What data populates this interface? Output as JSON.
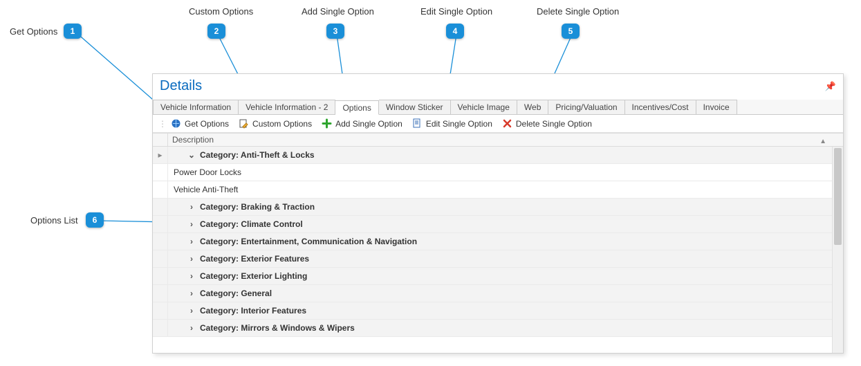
{
  "callouts": {
    "c1": {
      "num": "1",
      "label": "Get Options"
    },
    "c2": {
      "num": "2",
      "label": "Custom Options"
    },
    "c3": {
      "num": "3",
      "label": "Add Single Option"
    },
    "c4": {
      "num": "4",
      "label": "Edit Single Option"
    },
    "c5": {
      "num": "5",
      "label": "Delete Single Option"
    },
    "c6": {
      "num": "6",
      "label": "Options List"
    }
  },
  "panel": {
    "title": "Details"
  },
  "tabs": {
    "t0": "Vehicle Information",
    "t1": "Vehicle Information - 2",
    "t2": "Options",
    "t3": "Window Sticker",
    "t4": "Vehicle Image",
    "t5": "Web",
    "t6": "Pricing/Valuation",
    "t7": "Incentives/Cost",
    "t8": "Invoice"
  },
  "toolbar": {
    "get_options": "Get Options",
    "custom_options": "Custom Options",
    "add_single": "Add Single Option",
    "edit_single": "Edit Single Option",
    "delete_single": "Delete Single Option"
  },
  "grid": {
    "header": "Description",
    "rows": {
      "r0": {
        "text": "Category: Anti-Theft & Locks"
      },
      "r0a": {
        "text": "Power Door Locks"
      },
      "r0b": {
        "text": "Vehicle Anti-Theft"
      },
      "r1": {
        "text": "Category: Braking & Traction"
      },
      "r2": {
        "text": "Category: Climate Control"
      },
      "r3": {
        "text": "Category: Entertainment, Communication & Navigation"
      },
      "r4": {
        "text": "Category: Exterior Features"
      },
      "r5": {
        "text": "Category: Exterior Lighting"
      },
      "r6": {
        "text": "Category: General"
      },
      "r7": {
        "text": "Category: Interior Features"
      },
      "r8": {
        "text": "Category: Mirrors & Windows & Wipers"
      }
    }
  }
}
